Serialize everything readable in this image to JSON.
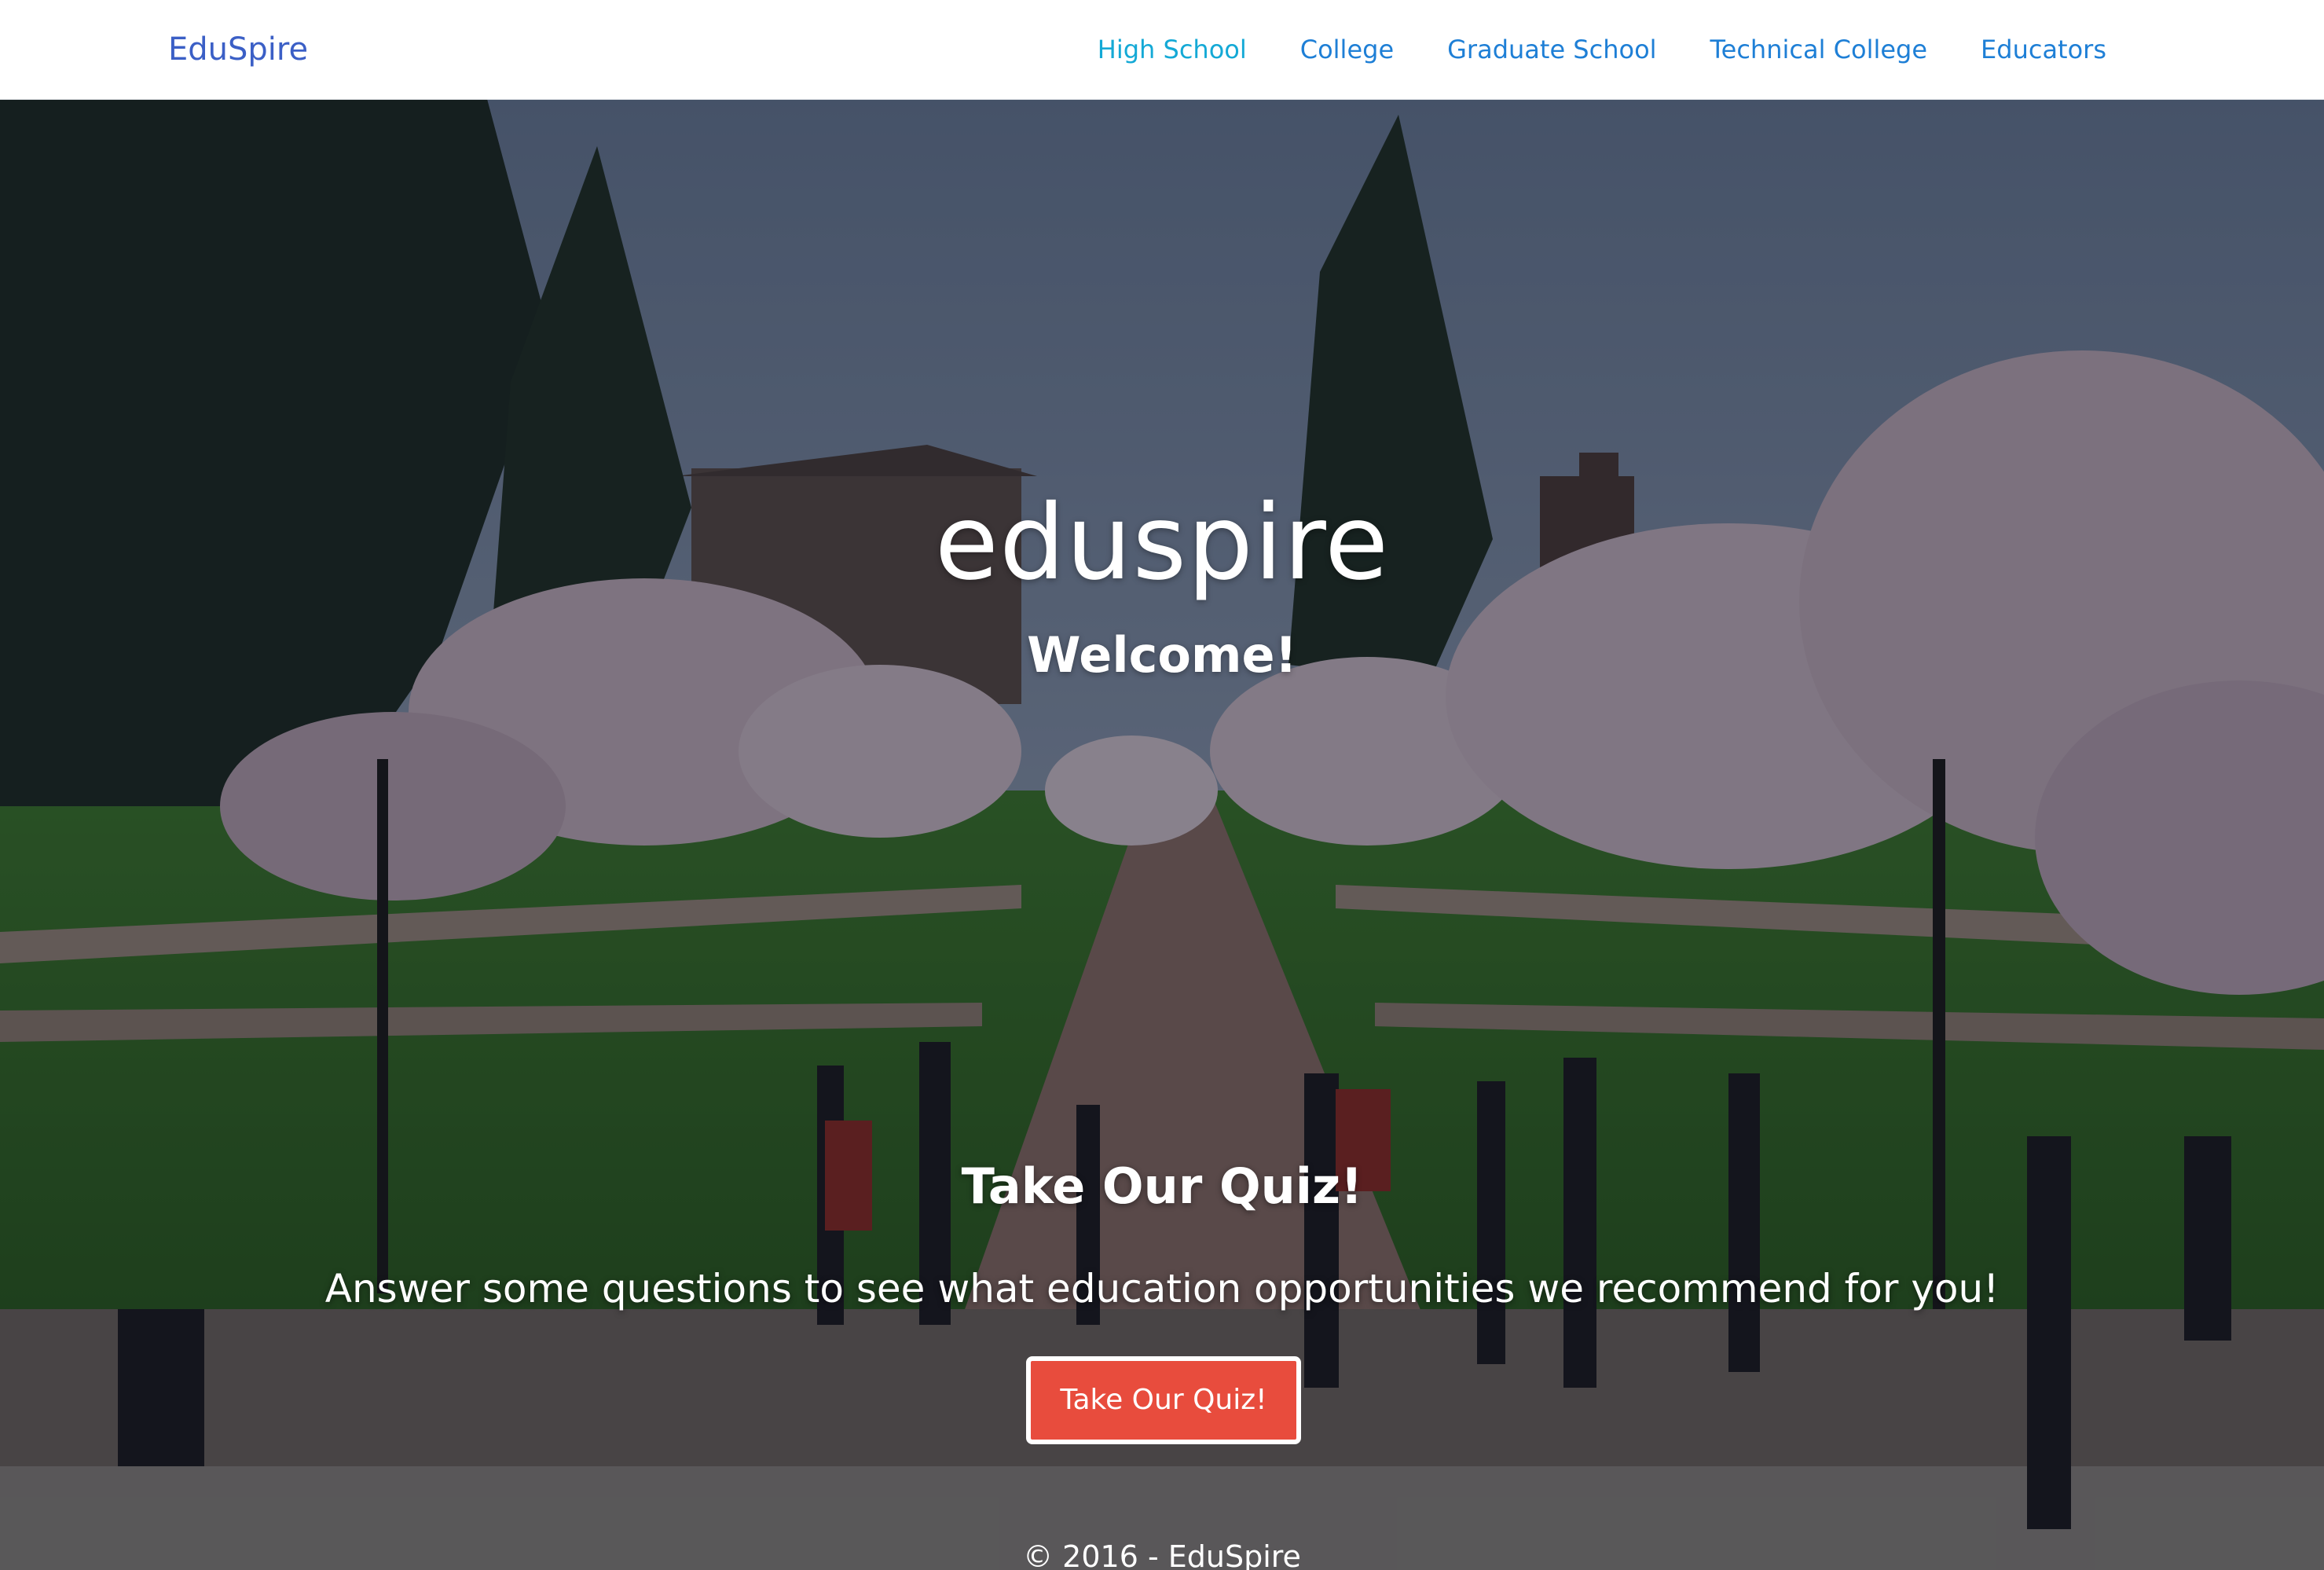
{
  "navbar": {
    "brand": "EduSpire",
    "links": [
      {
        "label": "High School"
      },
      {
        "label": "College"
      },
      {
        "label": "Graduate School"
      },
      {
        "label": "Technical College"
      },
      {
        "label": "Educators"
      }
    ]
  },
  "hero": {
    "title": "eduspire",
    "subtitle": "Welcome!",
    "quiz_heading": "Take Our Quiz!",
    "quiz_description": "Answer some questions to see what education opportunities we recommend for you!",
    "quiz_button_label": "Take Our Quiz!"
  },
  "footer": {
    "copyright": "© 2016 - EduSpire"
  },
  "colors": {
    "brand": "#3b5fc6",
    "nav_link": "#1e7fd6",
    "nav_link_active": "#14a9d6",
    "quiz_button": "#e84c3d",
    "overlay": "#0a0e1a"
  }
}
